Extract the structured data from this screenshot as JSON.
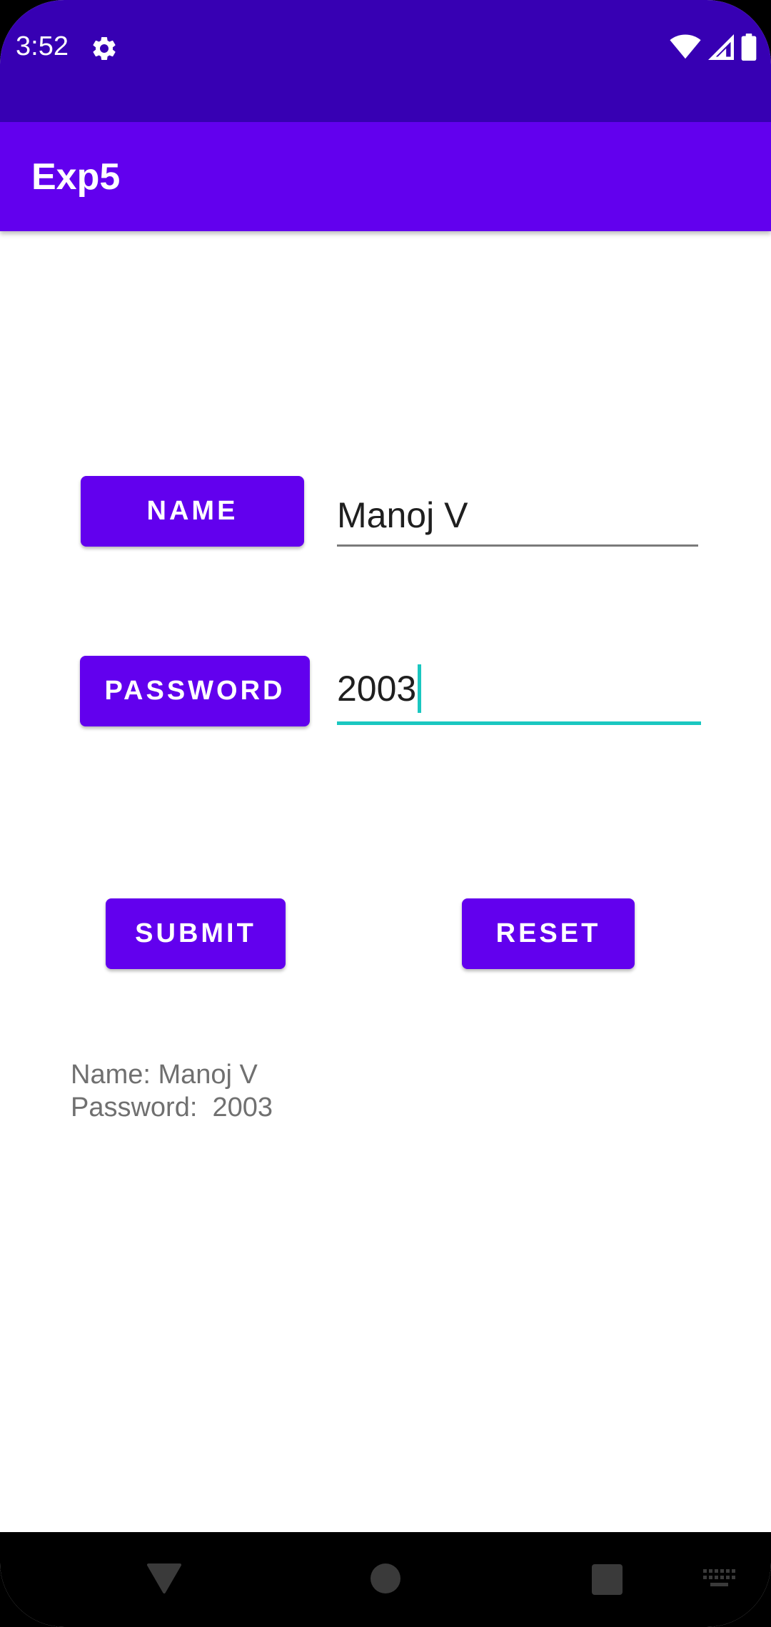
{
  "status_bar": {
    "time": "3:52",
    "left_icons": [
      "gear-icon"
    ],
    "right_icons": [
      "wifi-icon",
      "cell-signal-icon",
      "battery-icon"
    ],
    "color": "#3700B3"
  },
  "app_bar": {
    "title": "Exp5",
    "color": "#6200EE"
  },
  "form": {
    "name_button_label": "NAME",
    "name_value": "Manoj V",
    "password_button_label": "PASSWORD",
    "password_value": "2003",
    "focused_field": "password",
    "accent_color": "#1AC7C0"
  },
  "actions": {
    "submit_label": "SUBMIT",
    "reset_label": "RESET"
  },
  "output": {
    "name_line": "Name: Manoj V",
    "password_line": "Password:  2003"
  },
  "nav_bar": {
    "icons": [
      "back-icon",
      "home-icon",
      "recents-icon",
      "keyboard-icon"
    ]
  }
}
